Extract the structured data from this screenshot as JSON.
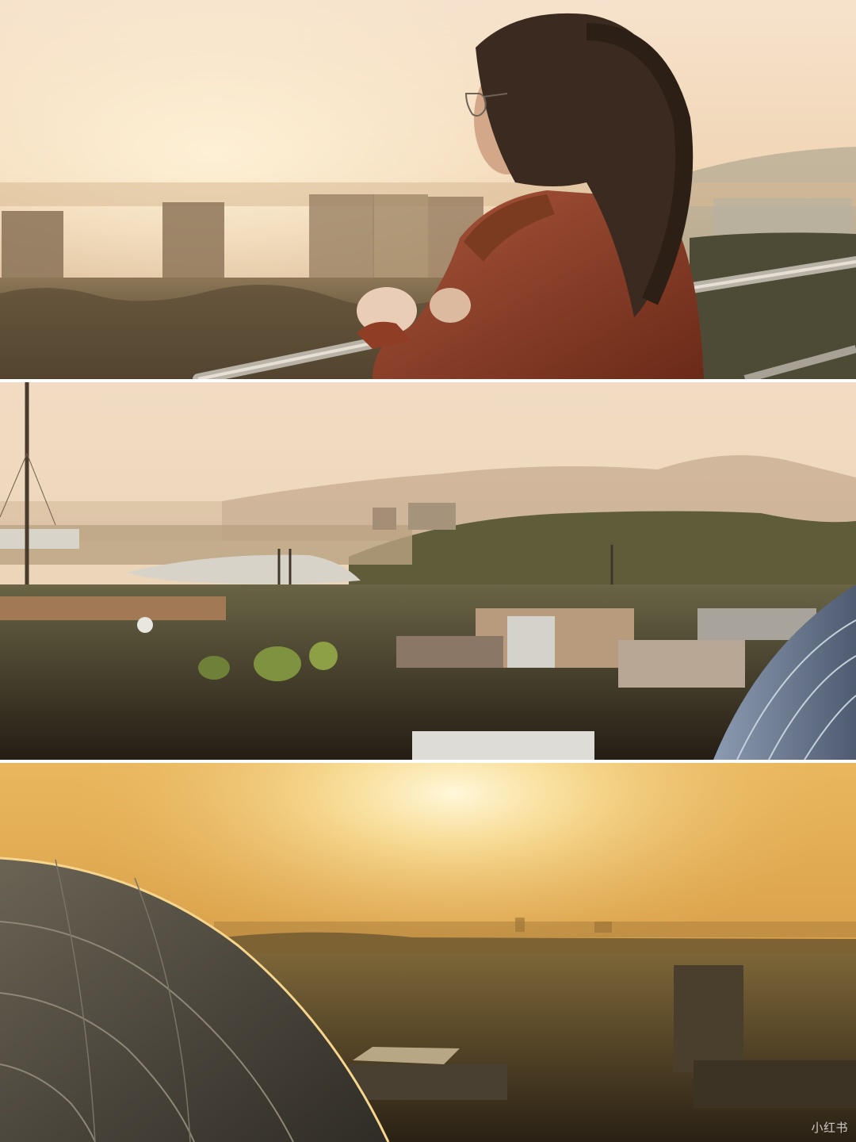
{
  "photos": [
    {
      "subject": "woman-at-railing-sunset"
    },
    {
      "subject": "valley-lake-campus-view"
    },
    {
      "subject": "dome-city-sunset"
    }
  ],
  "watermark": "小红书",
  "colors": {
    "sky_warm": "#f3dcc0",
    "haze": "#e8c79a",
    "coat": "#8a3a22",
    "dome": "#6f7d92",
    "sun_glow": "#fff2c0"
  }
}
